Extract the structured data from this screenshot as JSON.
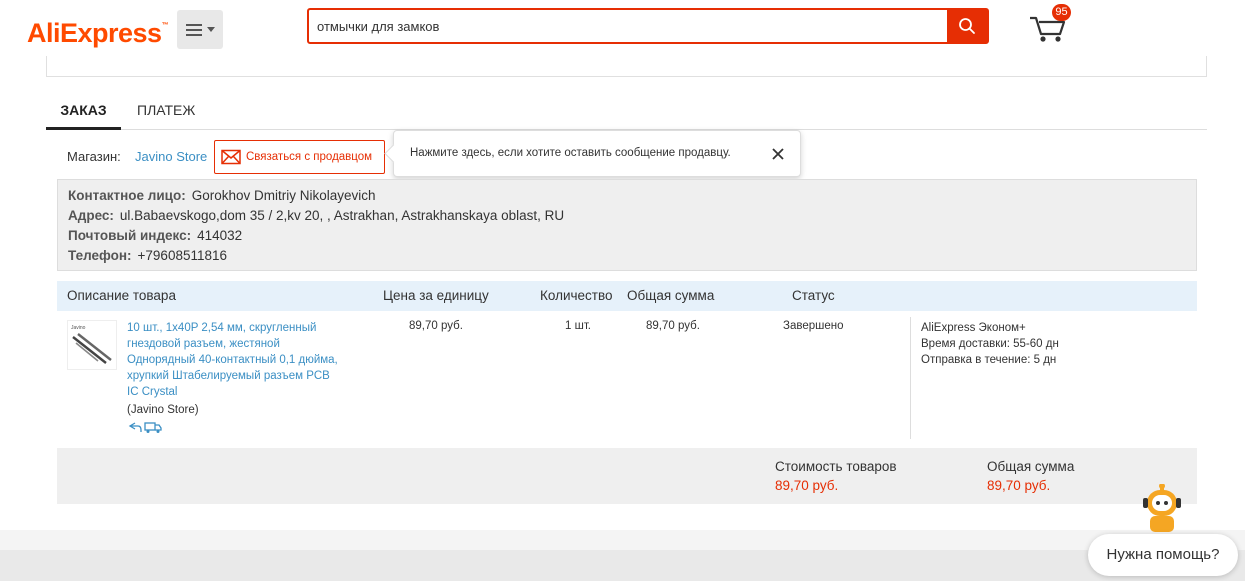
{
  "header": {
    "logo_text": "AliExpress",
    "search": {
      "value": "отмычки для замков"
    },
    "cart_count": "95"
  },
  "tabs": [
    {
      "label": "ЗАКАЗ"
    },
    {
      "label": "ПЛАТЕЖ"
    }
  ],
  "store": {
    "label": "Магазин:",
    "name": "Javino Store",
    "contact_label": "Связаться с продавцом",
    "tooltip": "Нажмите здесь, если хотите оставить сообщение продавцу."
  },
  "address": {
    "contact_label": "Контактное лицо:",
    "contact_value": "Gorokhov Dmitriy Nikolayevich",
    "address_label": "Адрес:",
    "address_value": "ul.Babaevskogo,dom 35 / 2,kv 20, , Astrakhan, Astrakhanskaya oblast, RU",
    "zip_label": "Почтовый индекс:",
    "zip_value": "414032",
    "phone_label": "Телефон:",
    "phone_value": "+79608511816"
  },
  "table": {
    "headers": [
      "Описание товара",
      "Цена за единицу",
      "Количество",
      "Общая сумма",
      "Статус"
    ],
    "product": {
      "image_label": "Javino",
      "title": "10 шт., 1x40P 2,54 мм, скругленный гнездовой разъем, жестяной Однорядный 40-контактный 0,1 дюйма, хрупкий Штабелируемый разъем PCB IC Crystal",
      "store": "(Javino Store)",
      "price": "89,70 руб.",
      "quantity": "1 шт.",
      "total": "89,70 руб.",
      "status": "Завершено",
      "shipping": [
        "AliExpress Эконом+",
        "Время доставки: 55-60 дн",
        "Отправка в течение: 5 дн"
      ]
    }
  },
  "summary": {
    "goods_label": "Стоимость товаров",
    "goods_value": "89,70 руб.",
    "total_label": "Общая сумма",
    "total_value": "89,70 руб."
  },
  "help": {
    "label": "Нужна помощь?"
  },
  "colors": {
    "brand": "#ff4a00",
    "accent": "#e62e04",
    "link": "#3b8fc4",
    "table_header": "#e6f1fa"
  }
}
